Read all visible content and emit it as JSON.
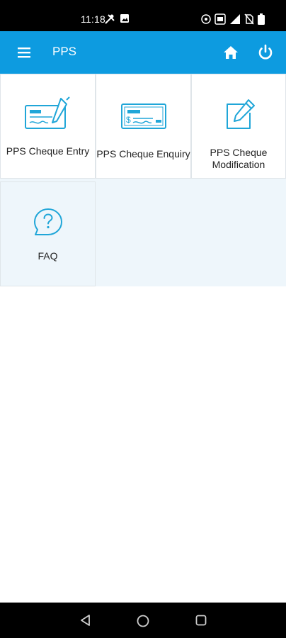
{
  "status_bar": {
    "time": "11:18"
  },
  "app_bar": {
    "title": "PPS",
    "icons": [
      "menu-icon",
      "home-icon",
      "power-icon"
    ]
  },
  "menu": {
    "tiles": [
      {
        "label": "PPS Cheque Entry",
        "icon": "cheque-sign-icon"
      },
      {
        "label": "PPS Cheque Enquiry",
        "icon": "cheque-icon"
      },
      {
        "label": "PPS Cheque Modification",
        "icon": "edit-icon"
      },
      {
        "label": "FAQ",
        "icon": "question-bubble-icon"
      }
    ]
  },
  "colors": {
    "app_bar": "#0d9be0",
    "icon_accent": "#20a6d8",
    "grid_background": "#eef6fb"
  },
  "nav_bar": {
    "icons": [
      "back-icon",
      "home-circle-icon",
      "recents-icon"
    ]
  }
}
